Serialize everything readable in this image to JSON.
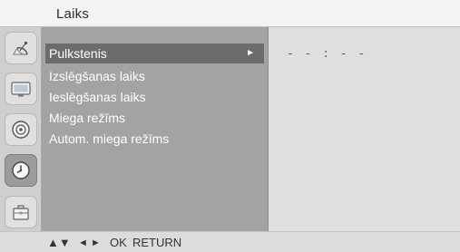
{
  "title": "Laiks",
  "sidebar": {
    "icons": [
      {
        "name": "satellite-dish-icon",
        "active": false
      },
      {
        "name": "monitor-picture-icon",
        "active": false
      },
      {
        "name": "speaker-audio-icon",
        "active": false
      },
      {
        "name": "clock-time-icon",
        "active": true
      },
      {
        "name": "options-toolbox-icon",
        "active": false
      }
    ]
  },
  "menu": {
    "items": [
      {
        "label": "Pulkstenis",
        "selected": true,
        "arrow": "►"
      },
      {
        "label": "Izslēgšanas laiks",
        "selected": false
      },
      {
        "label": "Ieslēgšanas laiks",
        "selected": false
      },
      {
        "label": "Miega režīms",
        "selected": false
      },
      {
        "label": "Autom. miega režīms",
        "selected": false
      }
    ]
  },
  "value_panel": {
    "clock": "- - : - -"
  },
  "footer": {
    "navigate_symbols": "▲▼",
    "adjust_symbols": "◄ ►",
    "ok_label": "OK",
    "return_label": "RETURN"
  },
  "colors": {
    "background": "#dcdcdc",
    "menu_panel": "#a3a3a3",
    "selected_item": "#6c6c6c",
    "title_bar": "#f3f3f3",
    "value_panel": "#dfdfdf"
  }
}
